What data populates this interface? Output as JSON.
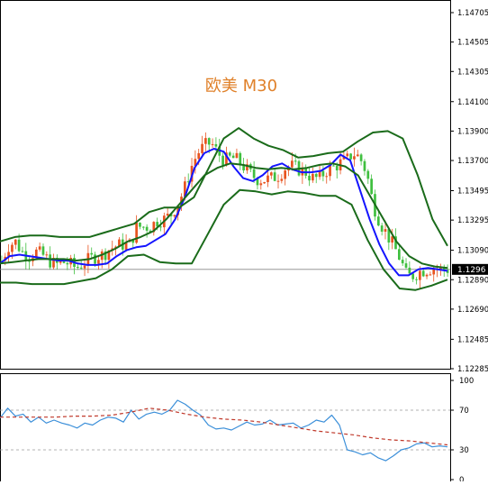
{
  "chart_data": [
    {
      "type": "line",
      "panel": "price",
      "title": "欧美 M30",
      "y_axis_ticks": [
        "1.14705",
        "1.14505",
        "1.14305",
        "1.14100",
        "1.13900",
        "1.13700",
        "1.13495",
        "1.13295",
        "1.13090",
        "1.12890",
        "1.12690",
        "1.12485",
        "1.12285"
      ],
      "ylim": [
        1.12285,
        1.14705
      ],
      "current_price_label": "1.1296",
      "current_price": 1.1296,
      "grid": false,
      "n_bars": 130,
      "candles": {
        "close": [
          1.1302,
          1.1312,
          1.1315,
          1.1308,
          1.1305,
          1.1308,
          1.1306,
          1.1302,
          1.1299,
          1.1301,
          1.13,
          1.1297,
          1.13,
          1.1303,
          1.1305,
          1.1306,
          1.131,
          1.1312,
          1.1313,
          1.1313,
          1.1325,
          1.1325,
          1.1325,
          1.1329,
          1.133,
          1.1333,
          1.134,
          1.135,
          1.1365,
          1.1375,
          1.138,
          1.1382,
          1.1375,
          1.137,
          1.1372,
          1.137,
          1.1365,
          1.136,
          1.1357,
          1.1357,
          1.1358,
          1.136,
          1.1365,
          1.1366,
          1.1364,
          1.1362,
          1.1358,
          1.1358,
          1.1363,
          1.1365,
          1.1368,
          1.137,
          1.1375,
          1.1372,
          1.1362,
          1.134,
          1.1328,
          1.132,
          1.1312,
          1.1303,
          1.1291,
          1.1292,
          1.1295,
          1.1296,
          1.1297,
          1.1296,
          1.1296
        ],
        "note": "Closes sampled every second bar (OHLC estimated from the chart)"
      },
      "series": [
        {
          "name": "",
          "color": "#1414ff",
          "role": "moving average",
          "values": [
            1.13,
            1.1305,
            1.1306,
            1.1305,
            1.1304,
            1.1303,
            1.1302,
            1.1302,
            1.13,
            1.1299,
            1.1299,
            1.13,
            1.1305,
            1.1309,
            1.1311,
            1.1312,
            1.1316,
            1.132,
            1.133,
            1.1345,
            1.1365,
            1.1375,
            1.1378,
            1.1376,
            1.1366,
            1.1358,
            1.1356,
            1.136,
            1.1366,
            1.1368,
            1.1364,
            1.1362,
            1.1362,
            1.1363,
            1.1367,
            1.1374,
            1.137,
            1.135,
            1.133,
            1.1313,
            1.13,
            1.1292,
            1.1292,
            1.1296,
            1.1297,
            1.1296,
            1.1295
          ]
        },
        {
          "name": "",
          "color": "#1a6b1a",
          "role": "bollinger middle",
          "values": [
            1.13,
            1.1301,
            1.1302,
            1.1303,
            1.1303,
            1.1303,
            1.1302,
            1.1303,
            1.1306,
            1.131,
            1.1315,
            1.1318,
            1.1322,
            1.133,
            1.134,
            1.135,
            1.136,
            1.1365,
            1.1368,
            1.1367,
            1.1365,
            1.1364,
            1.1365,
            1.1364,
            1.1365,
            1.1367,
            1.1368,
            1.1366,
            1.136,
            1.1345,
            1.133,
            1.1315,
            1.1305,
            1.13,
            1.1298,
            1.1297
          ]
        },
        {
          "name": "",
          "color": "#1a6b1a",
          "role": "bollinger upper",
          "values": [
            1.1315,
            1.1318,
            1.1319,
            1.1319,
            1.1318,
            1.1318,
            1.1318,
            1.1321,
            1.1324,
            1.1327,
            1.1335,
            1.1338,
            1.1338,
            1.1345,
            1.1365,
            1.1385,
            1.1392,
            1.1385,
            1.138,
            1.1377,
            1.1372,
            1.1373,
            1.1375,
            1.1376,
            1.1383,
            1.1389,
            1.139,
            1.1385,
            1.136,
            1.133,
            1.1312
          ]
        },
        {
          "name": "",
          "color": "#1a6b1a",
          "role": "bollinger lower",
          "values": [
            1.1287,
            1.1287,
            1.1286,
            1.1286,
            1.1286,
            1.1288,
            1.129,
            1.1296,
            1.1305,
            1.1306,
            1.1301,
            1.13,
            1.13,
            1.132,
            1.134,
            1.135,
            1.1349,
            1.1347,
            1.1349,
            1.1348,
            1.1346,
            1.1346,
            1.134,
            1.1316,
            1.1296,
            1.1283,
            1.1282,
            1.1285,
            1.1289
          ]
        }
      ]
    },
    {
      "type": "line",
      "panel": "oscillator",
      "y_axis_ticks": [
        "100",
        "70",
        "30",
        "0"
      ],
      "ylim": [
        0,
        100
      ],
      "levels": [
        70,
        30
      ],
      "series": [
        {
          "name": "",
          "color": "#3b8fd9",
          "values": [
            62,
            72,
            64,
            66,
            58,
            63,
            57,
            60,
            57,
            55,
            52,
            57,
            55,
            60,
            63,
            62,
            58,
            70,
            61,
            66,
            68,
            66,
            70,
            80,
            76,
            70,
            65,
            55,
            51,
            52,
            50,
            54,
            58,
            55,
            56,
            60,
            55,
            56,
            57,
            52,
            55,
            60,
            58,
            65,
            55,
            30,
            28,
            25,
            27,
            22,
            19,
            24,
            30,
            32,
            36,
            37,
            33,
            34,
            33
          ]
        },
        {
          "name": "",
          "color": "#c0392b",
          "style": "dashed",
          "values": [
            63,
            63,
            63,
            63,
            64,
            64,
            65,
            68,
            72,
            70,
            66,
            63,
            61,
            60,
            58,
            55,
            52,
            49,
            47,
            45,
            42,
            40,
            39,
            37,
            35
          ]
        }
      ]
    }
  ]
}
